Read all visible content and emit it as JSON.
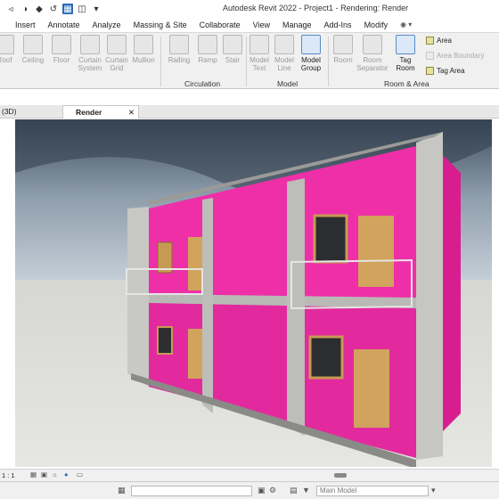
{
  "window": {
    "title": "Autodesk Revit 2022 - Project1 - Rendering: Render"
  },
  "quick_access": {
    "icons": [
      "home-icon",
      "open-icon",
      "save-icon",
      "sync-icon",
      "selection-icon",
      "print-icon",
      "dropdown-icon"
    ]
  },
  "ribbon_tabs": [
    "Insert",
    "Annotate",
    "Analyze",
    "Massing & Site",
    "Collaborate",
    "View",
    "Manage",
    "Add-Ins",
    "Modify"
  ],
  "ribbon": {
    "buttons": [
      {
        "label": "Roof",
        "enabled": false
      },
      {
        "label": "Ceiling",
        "enabled": false
      },
      {
        "label": "Floor",
        "enabled": false
      },
      {
        "label": "Curtain System",
        "enabled": false
      },
      {
        "label": "Curtain Grid",
        "enabled": false
      },
      {
        "label": "Mullion",
        "enabled": false
      },
      {
        "label": "Railing",
        "enabled": false
      },
      {
        "label": "Ramp",
        "enabled": false
      },
      {
        "label": "Stair",
        "enabled": false
      },
      {
        "label": "Model Text",
        "enabled": false
      },
      {
        "label": "Model Line",
        "enabled": false
      },
      {
        "label": "Model Group",
        "enabled": true
      },
      {
        "label": "Room",
        "enabled": false
      },
      {
        "label": "Room Separator",
        "enabled": false
      },
      {
        "label": "Tag Room",
        "enabled": true
      }
    ],
    "small_buttons": [
      {
        "label": "Area",
        "enabled": true
      },
      {
        "label": "Area Boundary",
        "enabled": false
      },
      {
        "label": "Tag Area",
        "enabled": true
      }
    ],
    "panels": [
      "Circulation",
      "Model",
      "Room & Area"
    ]
  },
  "view_tabs": [
    {
      "label": "(3D)",
      "active": false
    },
    {
      "label": "Render",
      "active": true
    }
  ],
  "view_control_bar": {
    "scale": "1 : 1"
  },
  "status_bar": {
    "model_selector": "Main Model"
  },
  "colors": {
    "wall_accent": "#e8259f",
    "ribbon_bg": "#f0f0f0",
    "active_tab": "#2a6bb5"
  }
}
